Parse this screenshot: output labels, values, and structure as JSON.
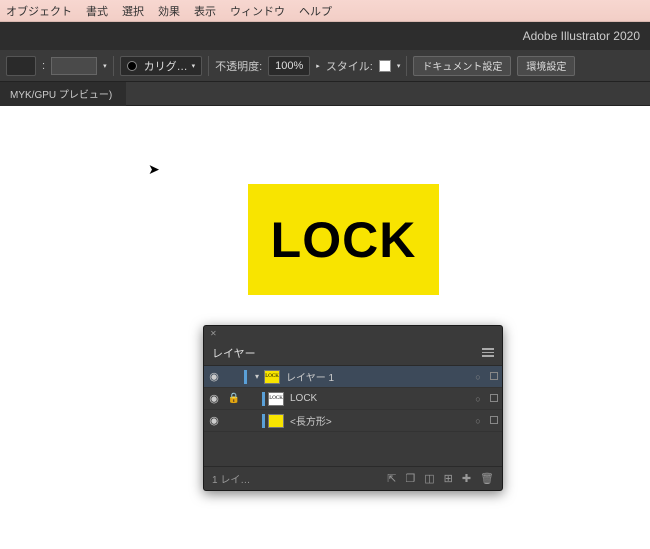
{
  "menu": {
    "items": [
      "オブジェクト",
      "書式",
      "選択",
      "効果",
      "表示",
      "ウィンドウ",
      "ヘルプ"
    ]
  },
  "app": {
    "title": "Adobe Illustrator 2020"
  },
  "ctrl": {
    "brush_name": "カリグ…",
    "opacity_label": "不透明度:",
    "opacity_value": "100%",
    "style_label": "スタイル:",
    "btn_doc": "ドキュメント設定",
    "btn_env": "環境設定"
  },
  "tab": {
    "label": "MYK/GPU プレビュー)"
  },
  "artwork": {
    "text": "LOCK"
  },
  "panel": {
    "title": "レイヤー",
    "rows": [
      {
        "name": "レイヤー 1",
        "bar": "#5aa0d8",
        "locked": false,
        "expandable": true
      },
      {
        "name": "LOCK",
        "bar": "#5aa0d8",
        "locked": true,
        "expandable": false
      },
      {
        "name": "<長方形>",
        "bar": "#5aa0d8",
        "locked": false,
        "expandable": false
      }
    ],
    "footer_count": "1 レイ…"
  }
}
